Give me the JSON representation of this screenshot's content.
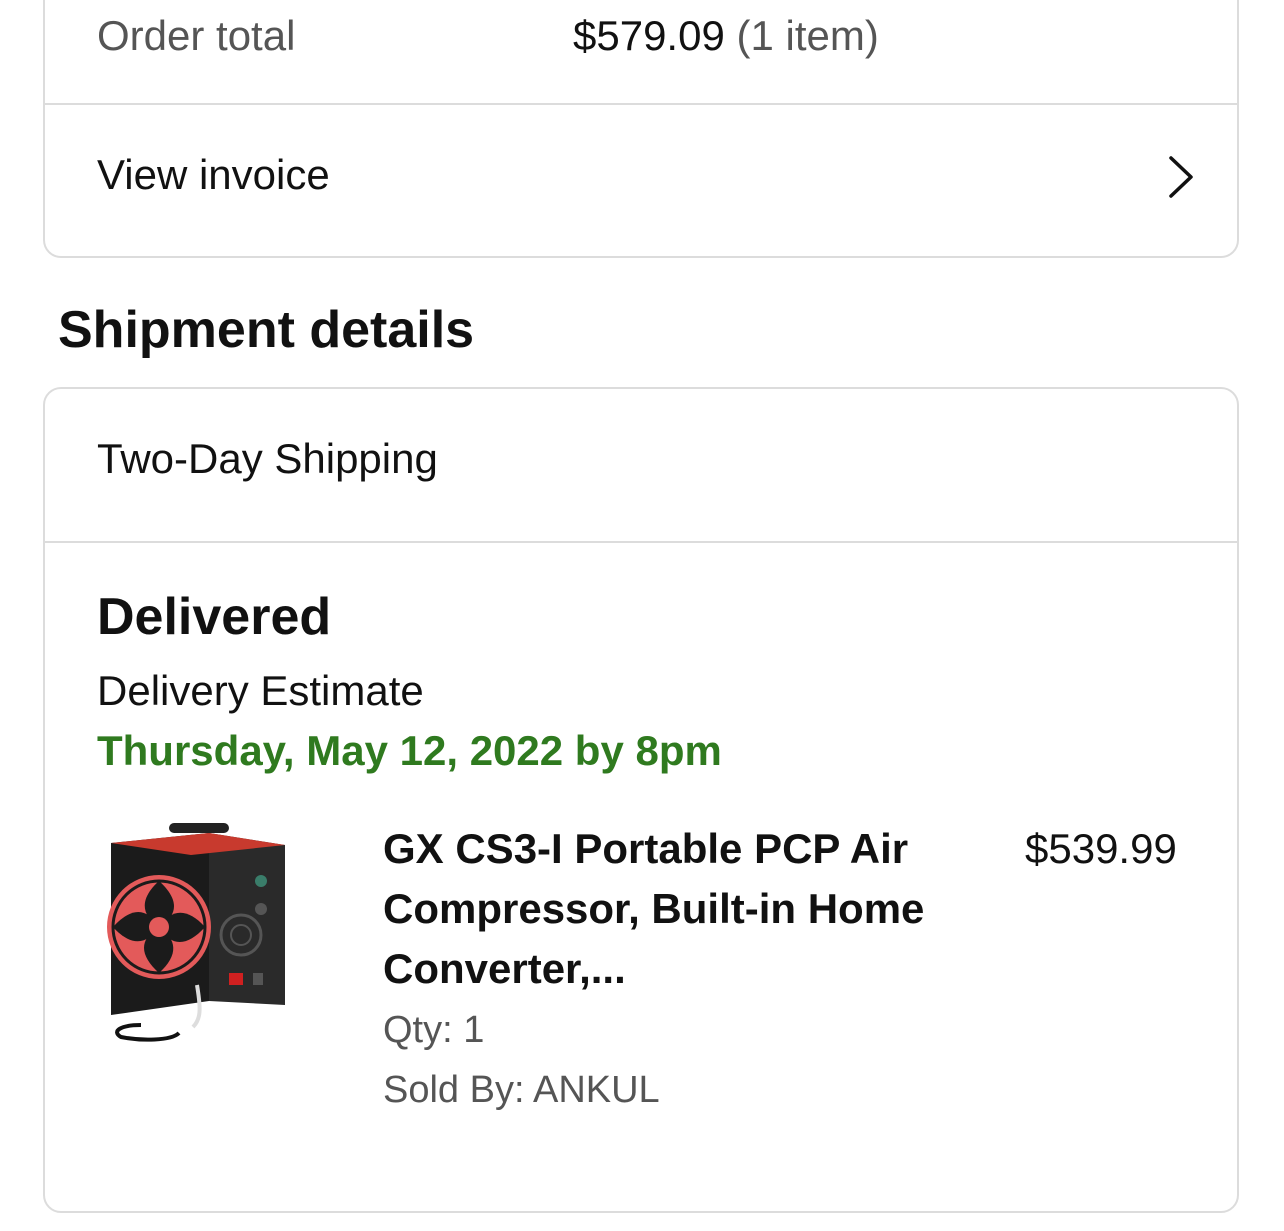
{
  "order_summary": {
    "order_total_label": "Order total",
    "order_total_value": "$579.09",
    "order_total_count": "(1 item)",
    "view_invoice_label": "View invoice"
  },
  "shipment": {
    "section_title": "Shipment details",
    "shipping_method": "Two-Day Shipping",
    "status": "Delivered",
    "estimate_label": "Delivery Estimate",
    "estimate_date": "Thursday, May 12, 2022 by 8pm",
    "estimate_color": "#2f7a1f",
    "item": {
      "title": "GX CS3-I Portable PCP Air Compressor, Built-in Home Converter,...",
      "qty": "Qty: 1",
      "sold_by": "Sold By: ANKUL",
      "price": "$539.99"
    }
  }
}
